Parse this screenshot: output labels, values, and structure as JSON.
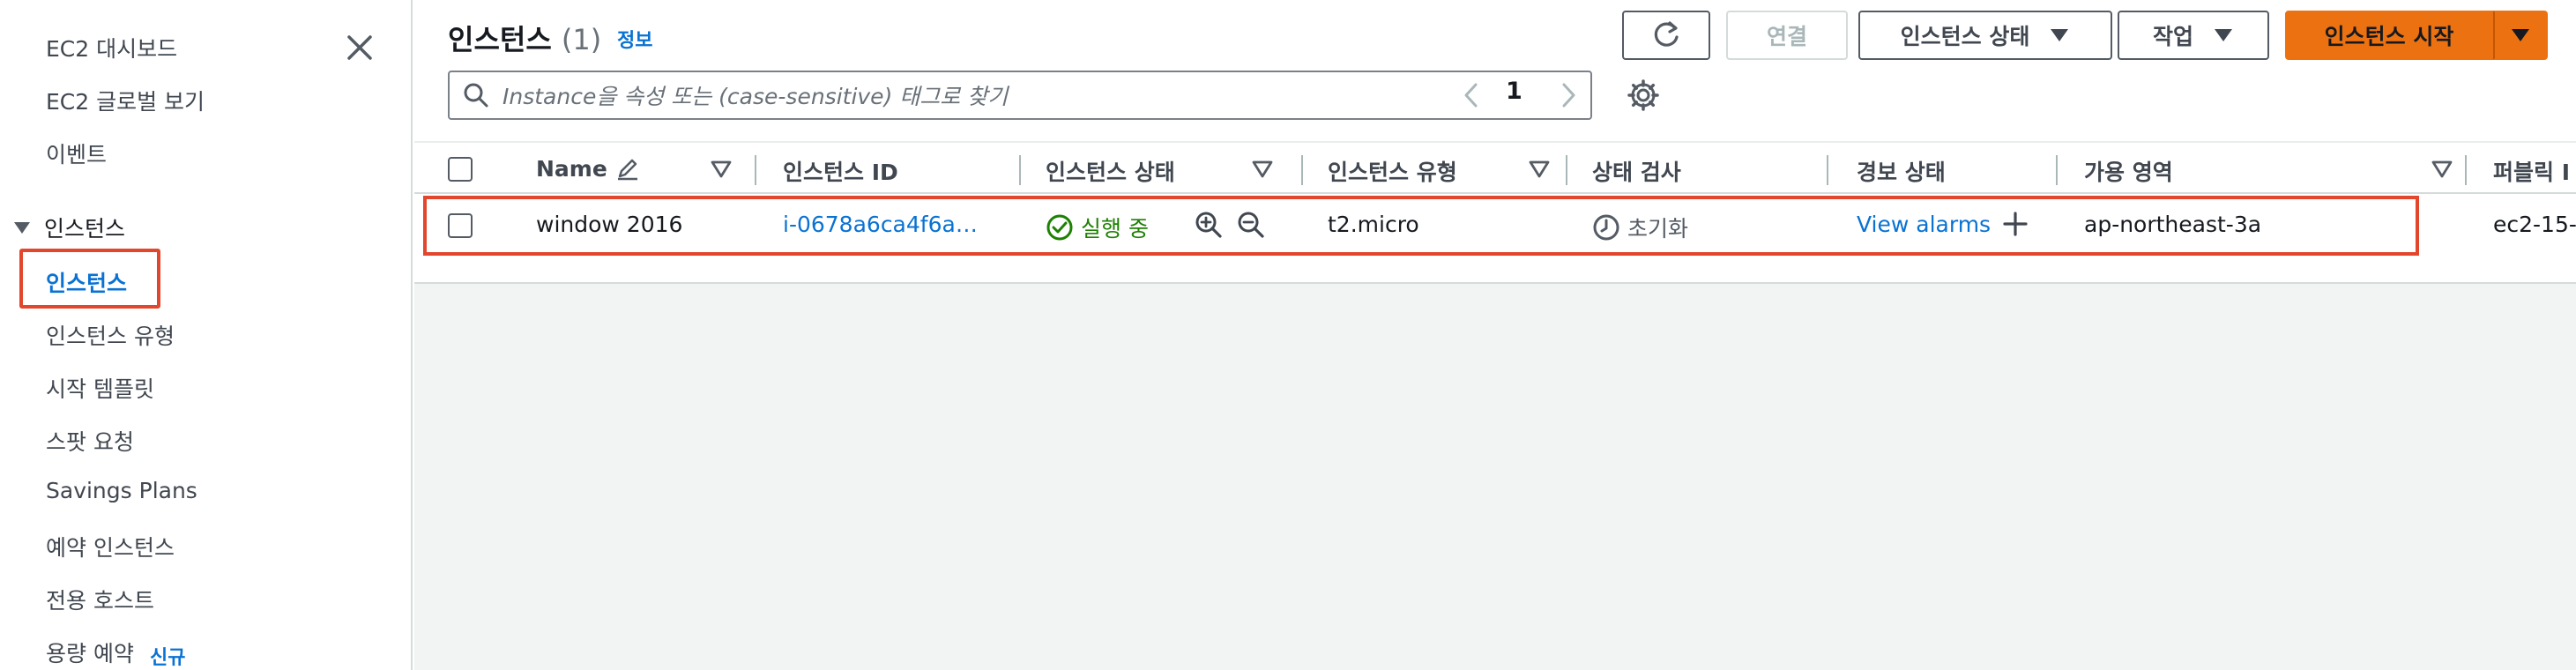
{
  "sidebar": {
    "items_top": [
      "EC2 대시보드",
      "EC2 글로벌 보기",
      "이벤트"
    ],
    "section_label": "인스턴스",
    "active_item": "인스턴스",
    "items_bottom": [
      "인스턴스 유형",
      "시작 템플릿",
      "스팟 요청",
      "Savings Plans",
      "예약 인스턴스",
      "전용 호스트",
      "용량 예약"
    ],
    "new_badge": "신규"
  },
  "header": {
    "title": "인스턴스",
    "count": "(1)",
    "info_link": "정보"
  },
  "toolbar": {
    "connect_label": "연결",
    "state_label": "인스턴스 상태",
    "actions_label": "작업",
    "launch_label": "인스턴스 시작"
  },
  "search": {
    "placeholder": "Instance을 속성 또는 (case-sensitive) 태그로 찾기"
  },
  "pagination": {
    "current_page": "1"
  },
  "table": {
    "columns": [
      "Name",
      "인스턴스 ID",
      "인스턴스 상태",
      "인스턴스 유형",
      "상태 검사",
      "경보 상태",
      "가용 영역",
      "퍼블릭 I"
    ],
    "rows": [
      {
        "name": "window 2016",
        "instance_id": "i-0678a6ca4f6a…",
        "state": "실행 중",
        "type": "t2.micro",
        "status_check": "초기화",
        "alarm": "View alarms",
        "az": "ap-northeast-3a",
        "public_dns": "ec2-15-"
      }
    ]
  },
  "colors": {
    "accent": "#0972d3",
    "primary_button": "#ec7211",
    "running": "#1d8102",
    "highlight": "#e2462c"
  },
  "icons": [
    "close-icon",
    "caret-down-icon",
    "refresh-icon",
    "search-icon",
    "chevron-left-icon",
    "chevron-right-icon",
    "settings-icon",
    "edit-icon",
    "filter-icon",
    "check-circle-icon",
    "zoom-in-icon",
    "zoom-out-icon",
    "clock-icon",
    "plus-icon"
  ]
}
